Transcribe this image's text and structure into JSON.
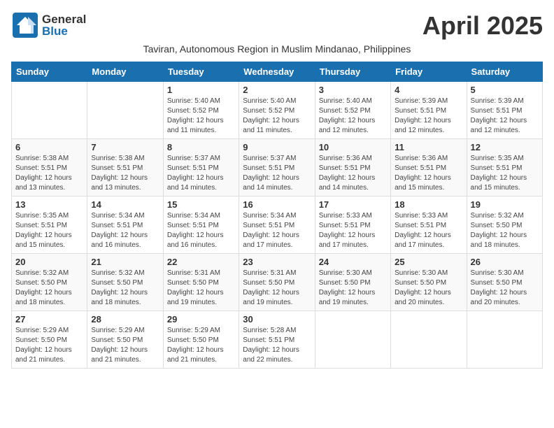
{
  "header": {
    "logo_general": "General",
    "logo_blue": "Blue",
    "month_year": "April 2025",
    "subtitle": "Taviran, Autonomous Region in Muslim Mindanao, Philippines"
  },
  "days_of_week": [
    "Sunday",
    "Monday",
    "Tuesday",
    "Wednesday",
    "Thursday",
    "Friday",
    "Saturday"
  ],
  "weeks": [
    [
      {
        "day": "",
        "info": ""
      },
      {
        "day": "",
        "info": ""
      },
      {
        "day": "1",
        "info": "Sunrise: 5:40 AM\nSunset: 5:52 PM\nDaylight: 12 hours and 11 minutes."
      },
      {
        "day": "2",
        "info": "Sunrise: 5:40 AM\nSunset: 5:52 PM\nDaylight: 12 hours and 11 minutes."
      },
      {
        "day": "3",
        "info": "Sunrise: 5:40 AM\nSunset: 5:52 PM\nDaylight: 12 hours and 12 minutes."
      },
      {
        "day": "4",
        "info": "Sunrise: 5:39 AM\nSunset: 5:51 PM\nDaylight: 12 hours and 12 minutes."
      },
      {
        "day": "5",
        "info": "Sunrise: 5:39 AM\nSunset: 5:51 PM\nDaylight: 12 hours and 12 minutes."
      }
    ],
    [
      {
        "day": "6",
        "info": "Sunrise: 5:38 AM\nSunset: 5:51 PM\nDaylight: 12 hours and 13 minutes."
      },
      {
        "day": "7",
        "info": "Sunrise: 5:38 AM\nSunset: 5:51 PM\nDaylight: 12 hours and 13 minutes."
      },
      {
        "day": "8",
        "info": "Sunrise: 5:37 AM\nSunset: 5:51 PM\nDaylight: 12 hours and 14 minutes."
      },
      {
        "day": "9",
        "info": "Sunrise: 5:37 AM\nSunset: 5:51 PM\nDaylight: 12 hours and 14 minutes."
      },
      {
        "day": "10",
        "info": "Sunrise: 5:36 AM\nSunset: 5:51 PM\nDaylight: 12 hours and 14 minutes."
      },
      {
        "day": "11",
        "info": "Sunrise: 5:36 AM\nSunset: 5:51 PM\nDaylight: 12 hours and 15 minutes."
      },
      {
        "day": "12",
        "info": "Sunrise: 5:35 AM\nSunset: 5:51 PM\nDaylight: 12 hours and 15 minutes."
      }
    ],
    [
      {
        "day": "13",
        "info": "Sunrise: 5:35 AM\nSunset: 5:51 PM\nDaylight: 12 hours and 15 minutes."
      },
      {
        "day": "14",
        "info": "Sunrise: 5:34 AM\nSunset: 5:51 PM\nDaylight: 12 hours and 16 minutes."
      },
      {
        "day": "15",
        "info": "Sunrise: 5:34 AM\nSunset: 5:51 PM\nDaylight: 12 hours and 16 minutes."
      },
      {
        "day": "16",
        "info": "Sunrise: 5:34 AM\nSunset: 5:51 PM\nDaylight: 12 hours and 17 minutes."
      },
      {
        "day": "17",
        "info": "Sunrise: 5:33 AM\nSunset: 5:51 PM\nDaylight: 12 hours and 17 minutes."
      },
      {
        "day": "18",
        "info": "Sunrise: 5:33 AM\nSunset: 5:51 PM\nDaylight: 12 hours and 17 minutes."
      },
      {
        "day": "19",
        "info": "Sunrise: 5:32 AM\nSunset: 5:50 PM\nDaylight: 12 hours and 18 minutes."
      }
    ],
    [
      {
        "day": "20",
        "info": "Sunrise: 5:32 AM\nSunset: 5:50 PM\nDaylight: 12 hours and 18 minutes."
      },
      {
        "day": "21",
        "info": "Sunrise: 5:32 AM\nSunset: 5:50 PM\nDaylight: 12 hours and 18 minutes."
      },
      {
        "day": "22",
        "info": "Sunrise: 5:31 AM\nSunset: 5:50 PM\nDaylight: 12 hours and 19 minutes."
      },
      {
        "day": "23",
        "info": "Sunrise: 5:31 AM\nSunset: 5:50 PM\nDaylight: 12 hours and 19 minutes."
      },
      {
        "day": "24",
        "info": "Sunrise: 5:30 AM\nSunset: 5:50 PM\nDaylight: 12 hours and 19 minutes."
      },
      {
        "day": "25",
        "info": "Sunrise: 5:30 AM\nSunset: 5:50 PM\nDaylight: 12 hours and 20 minutes."
      },
      {
        "day": "26",
        "info": "Sunrise: 5:30 AM\nSunset: 5:50 PM\nDaylight: 12 hours and 20 minutes."
      }
    ],
    [
      {
        "day": "27",
        "info": "Sunrise: 5:29 AM\nSunset: 5:50 PM\nDaylight: 12 hours and 21 minutes."
      },
      {
        "day": "28",
        "info": "Sunrise: 5:29 AM\nSunset: 5:50 PM\nDaylight: 12 hours and 21 minutes."
      },
      {
        "day": "29",
        "info": "Sunrise: 5:29 AM\nSunset: 5:50 PM\nDaylight: 12 hours and 21 minutes."
      },
      {
        "day": "30",
        "info": "Sunrise: 5:28 AM\nSunset: 5:51 PM\nDaylight: 12 hours and 22 minutes."
      },
      {
        "day": "",
        "info": ""
      },
      {
        "day": "",
        "info": ""
      },
      {
        "day": "",
        "info": ""
      }
    ]
  ]
}
